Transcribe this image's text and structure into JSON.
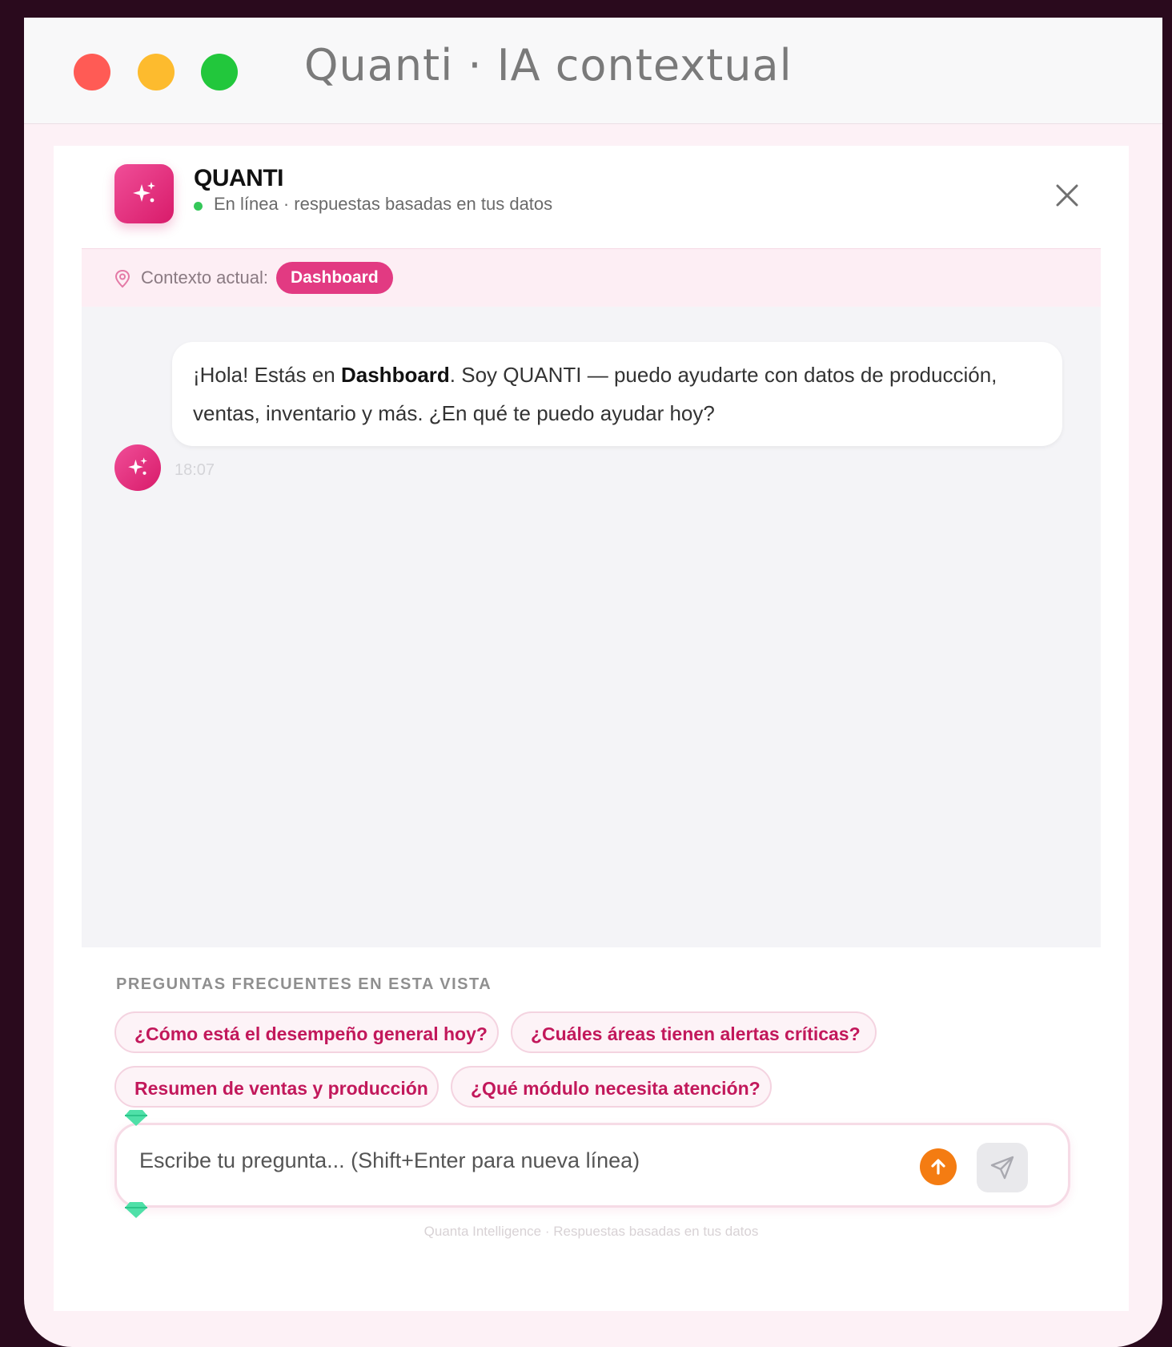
{
  "window": {
    "title": "Quanti · IA contextual"
  },
  "header": {
    "brand": "QUANTI",
    "status": "En línea · respuestas basadas en tus datos",
    "logo_icon": "sparkles-icon",
    "close_icon": "close-icon"
  },
  "context": {
    "label": "Contexto actual:",
    "value": "Dashboard",
    "icon": "map-pin-icon"
  },
  "messages": [
    {
      "sender": "QUANTI",
      "parts": {
        "before": "¡Hola! Estás en ",
        "bold": "Dashboard",
        "after": ". Soy QUANTI — puedo ayudarte con datos de producción, ventas, inventario y más. ¿En qué te puedo ayudar hoy?"
      },
      "time": "18:07"
    }
  ],
  "faq": {
    "title": "PREGUNTAS FRECUENTES EN ESTA VISTA",
    "chips": [
      "¿Cómo está el desempeño general hoy?",
      "¿Cuáles áreas tienen alertas críticas?",
      "Resumen de ventas y producción",
      "¿Qué módulo necesita atención?"
    ]
  },
  "composer": {
    "placeholder": "Escribe tu pregunta... (Shift+Enter para nueva línea)",
    "value": "",
    "upload_icon": "arrow-up-icon",
    "send_icon": "send-icon"
  },
  "footer": {
    "note": "Quanta Intelligence · Respuestas basadas en tus datos"
  },
  "colors": {
    "accent": "#e23a82",
    "accent_dark": "#c2185b",
    "online": "#34c759",
    "upload": "#f47c12",
    "background": "#2a0a1d"
  }
}
